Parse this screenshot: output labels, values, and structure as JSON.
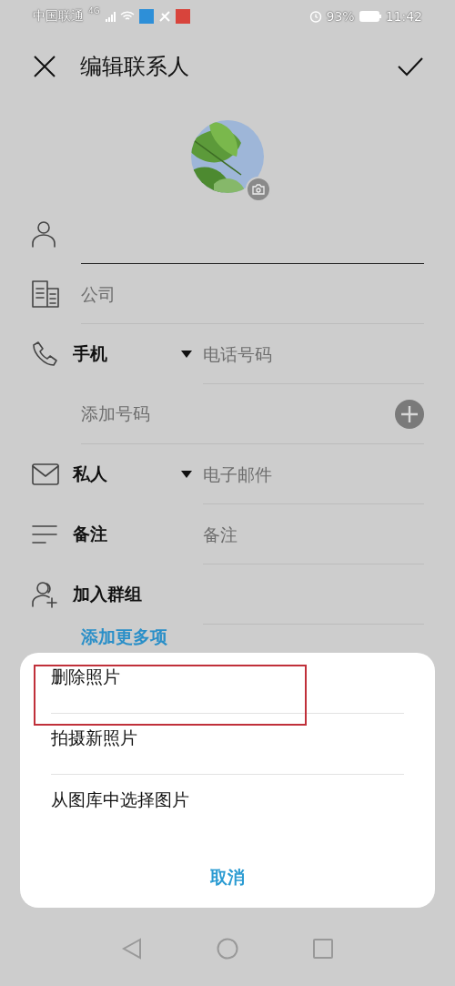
{
  "status_bar": {
    "carrier": "中国联通",
    "network": "4G",
    "battery_percent": "93%",
    "time": "11:42"
  },
  "header": {
    "title": "编辑联系人"
  },
  "fields": [
    {
      "kind": "name",
      "focused": true
    },
    {
      "kind": "plain",
      "placeholder": "公司",
      "focused": false
    },
    {
      "kind": "typed",
      "type_label": "手机",
      "placeholder": "电话号码",
      "focused": false
    },
    {
      "kind": "add",
      "label": "添加号码"
    },
    {
      "kind": "typed",
      "type_label": "私人",
      "placeholder": "电子邮件",
      "focused": false
    },
    {
      "kind": "labeled",
      "label": "备注",
      "placeholder": "备注",
      "focused": false
    },
    {
      "kind": "labeled",
      "label": "加入群组",
      "focused": false
    }
  ],
  "add_more_link": "添加更多项",
  "photo_sheet": {
    "items": [
      {
        "label": "删除照片",
        "highlighted": true
      },
      {
        "label": "拍摄新照片",
        "highlighted": false
      },
      {
        "label": "从图库中选择图片",
        "highlighted": false
      }
    ],
    "cancel": "取消"
  }
}
